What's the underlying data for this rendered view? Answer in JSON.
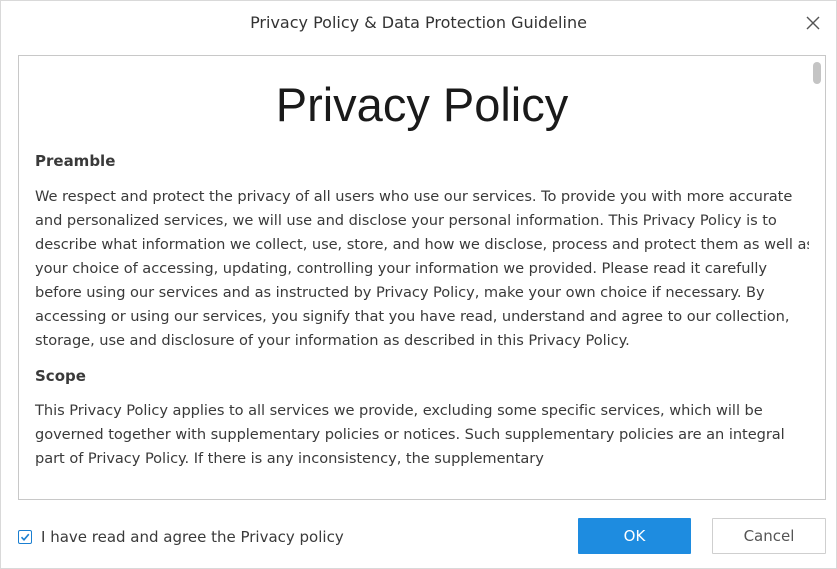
{
  "window": {
    "title": "Privacy Policy & Data Protection Guideline",
    "close_icon": "close-icon"
  },
  "document": {
    "title": "Privacy Policy",
    "sections": [
      {
        "heading": "Preamble",
        "text": "We respect and protect the privacy of all users who use our services. To provide you with more accurate and personalized services, we will use and disclose your personal information. This Privacy Policy is to describe what information we collect, use, store, and how we disclose, process and protect them as well as your choice of accessing, updating, controlling your information we provided. Please read it carefully before using our services and as instructed by Privacy Policy, make your own choice if necessary. By accessing or using our services, you signify that you have read, understand and agree to our collection, storage, use and disclosure of your information as described in this Privacy Policy."
      },
      {
        "heading": "Scope",
        "text": "This Privacy Policy applies to all services we provide, excluding some specific services, which will be governed together with supplementary policies or notices. Such supplementary policies are an integral part of Privacy Policy. If there is any inconsistency, the supplementary"
      }
    ]
  },
  "footer": {
    "agree_checkbox": {
      "label": "I have read and agree the Privacy policy",
      "checked": true
    },
    "ok_label": "OK",
    "cancel_label": "Cancel"
  },
  "colors": {
    "accent": "#1e8ce0",
    "checkbox": "#1a7fd1",
    "border": "#c8c8c8"
  }
}
